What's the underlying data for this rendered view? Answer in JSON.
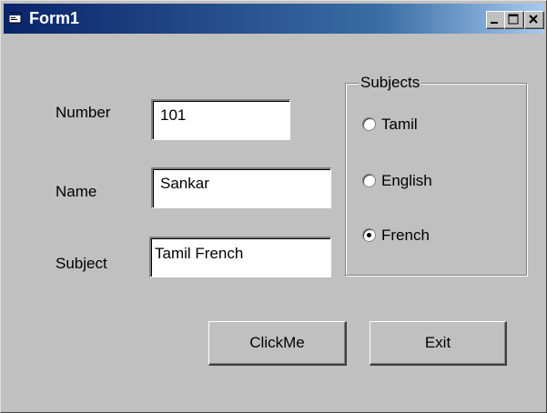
{
  "window": {
    "title": "Form1"
  },
  "fields": {
    "number": {
      "label": "Number",
      "value": "101"
    },
    "name": {
      "label": "Name",
      "value": "Sankar"
    },
    "subject": {
      "label": "Subject",
      "value": "Tamil  French"
    }
  },
  "subjects_group": {
    "title": "Subjects",
    "options": [
      {
        "label": "Tamil",
        "selected": false
      },
      {
        "label": "English",
        "selected": false
      },
      {
        "label": "French",
        "selected": true
      }
    ]
  },
  "buttons": {
    "click_me": "ClickMe",
    "exit": "Exit"
  }
}
